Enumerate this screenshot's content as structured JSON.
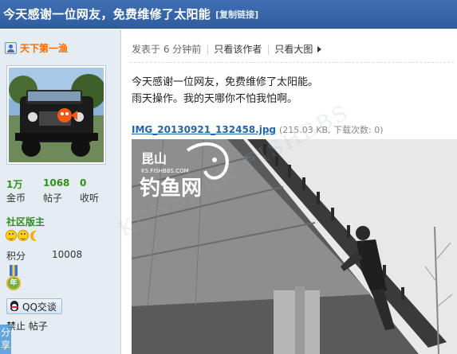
{
  "thread": {
    "title": "今天感谢一位网友，免费维修了太阳能",
    "copy_link": "[复制链接]"
  },
  "author": {
    "username": "天下第一渔",
    "stats": [
      {
        "value": "1万",
        "label": "金币"
      },
      {
        "value": "1068",
        "label": "帖子"
      },
      {
        "value": "0",
        "label": "收听"
      }
    ],
    "rank": "社区版主",
    "points_label": "积分",
    "points_value": "10008",
    "medal_text": "年",
    "qq_button": "QQ交谈",
    "ban_text": "禁止 帖子",
    "share_tab": "分享"
  },
  "post": {
    "posted": "发表于 6 分钟前",
    "only_author": "只看该作者",
    "only_large": "只看大图",
    "line1": "今天感谢一位网友，免费维修了太阳能。",
    "line2": "雨天操作。我的天哪你不怕我怕啊。",
    "attachment": {
      "filename": "IMG_20130921_132458.jpg",
      "meta": "(215.03 KB, 下载次数: 0)"
    }
  },
  "watermark": {
    "top": "昆山",
    "site": "KS.FISHBBS.COM",
    "bottom": "钓鱼网",
    "background": "KUNSHAN FISHBBS"
  },
  "colors": {
    "title_bar": "#3466a9",
    "sidebar": "#e5edf2",
    "username": "#f26c00",
    "stat_value": "#2f8f1f",
    "link": "#2366a8"
  }
}
